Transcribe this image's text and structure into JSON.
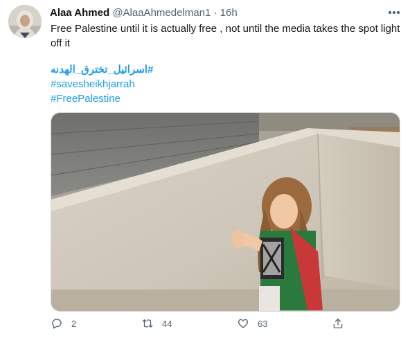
{
  "tweet": {
    "author_name": "Alaa Ahmed",
    "handle": "@AlaaAhmedelman1",
    "separator": "·",
    "time": "16h",
    "text": "Free Palestine until it is actually free , not until the media takes the spot light off it",
    "hashtags": [
      "#اسرائيل_تخترق_الهدنه",
      "#savesheikhjarrah",
      "#FreePalestine"
    ]
  },
  "actions": {
    "reply_count": "2",
    "retweet_count": "44",
    "like_count": "63"
  },
  "icons": {
    "more": "more-options-icon",
    "reply": "reply-icon",
    "retweet": "retweet-icon",
    "like": "heart-icon",
    "share": "share-icon"
  },
  "colors": {
    "link": "#1d9bf0",
    "secondary": "#536471",
    "text": "#0f1419"
  }
}
